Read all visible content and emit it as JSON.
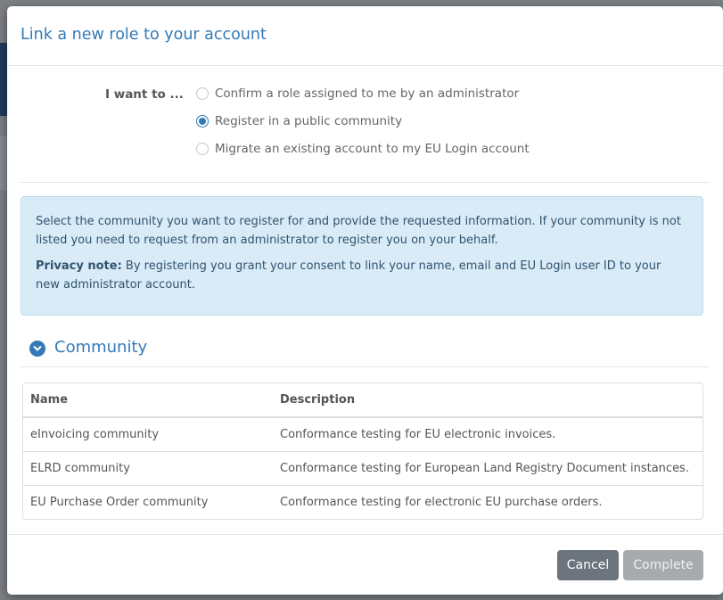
{
  "modal": {
    "title": "Link a new role to your account"
  },
  "choice": {
    "label": "I want to ...",
    "options": [
      {
        "label": "Confirm a role assigned to me by an administrator",
        "checked": false
      },
      {
        "label": "Register in a public community",
        "checked": true
      },
      {
        "label": "Migrate an existing account to my EU Login account",
        "checked": false
      }
    ]
  },
  "info": {
    "text": "Select the community you want to register for and provide the requested information. If your community is not listed you need to request from an administrator to register you on your behalf.",
    "privacy_label": "Privacy note:",
    "privacy_text": " By registering you grant your consent to link your name, email and EU Login user ID to your new administrator account."
  },
  "section": {
    "title": "Community",
    "icon": "chevron-down-icon"
  },
  "table": {
    "headers": [
      "Name",
      "Description"
    ],
    "rows": [
      [
        "eInvoicing community",
        "Conformance testing for EU electronic invoices."
      ],
      [
        "ELRD community",
        "Conformance testing for European Land Registry Document instances."
      ],
      [
        "EU Purchase Order community",
        "Conformance testing for electronic EU purchase orders."
      ]
    ]
  },
  "footer": {
    "cancel_label": "Cancel",
    "complete_label": "Complete"
  },
  "colors": {
    "accent": "#337ab7",
    "info_bg": "#d9ebf7",
    "cancel_bg": "#6c757d",
    "complete_disabled_bg": "#a7abae"
  }
}
